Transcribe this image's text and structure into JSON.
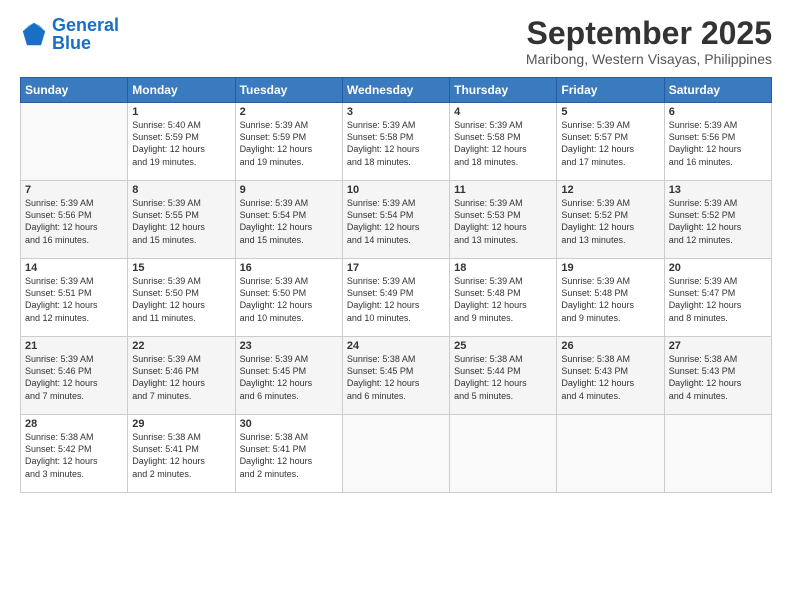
{
  "logo": {
    "line1": "General",
    "line2": "Blue"
  },
  "title": "September 2025",
  "location": "Maribong, Western Visayas, Philippines",
  "days_of_week": [
    "Sunday",
    "Monday",
    "Tuesday",
    "Wednesday",
    "Thursday",
    "Friday",
    "Saturday"
  ],
  "weeks": [
    [
      {
        "day": "",
        "info": ""
      },
      {
        "day": "1",
        "info": "Sunrise: 5:40 AM\nSunset: 5:59 PM\nDaylight: 12 hours\nand 19 minutes."
      },
      {
        "day": "2",
        "info": "Sunrise: 5:39 AM\nSunset: 5:59 PM\nDaylight: 12 hours\nand 19 minutes."
      },
      {
        "day": "3",
        "info": "Sunrise: 5:39 AM\nSunset: 5:58 PM\nDaylight: 12 hours\nand 18 minutes."
      },
      {
        "day": "4",
        "info": "Sunrise: 5:39 AM\nSunset: 5:58 PM\nDaylight: 12 hours\nand 18 minutes."
      },
      {
        "day": "5",
        "info": "Sunrise: 5:39 AM\nSunset: 5:57 PM\nDaylight: 12 hours\nand 17 minutes."
      },
      {
        "day": "6",
        "info": "Sunrise: 5:39 AM\nSunset: 5:56 PM\nDaylight: 12 hours\nand 16 minutes."
      }
    ],
    [
      {
        "day": "7",
        "info": "Sunrise: 5:39 AM\nSunset: 5:56 PM\nDaylight: 12 hours\nand 16 minutes."
      },
      {
        "day": "8",
        "info": "Sunrise: 5:39 AM\nSunset: 5:55 PM\nDaylight: 12 hours\nand 15 minutes."
      },
      {
        "day": "9",
        "info": "Sunrise: 5:39 AM\nSunset: 5:54 PM\nDaylight: 12 hours\nand 15 minutes."
      },
      {
        "day": "10",
        "info": "Sunrise: 5:39 AM\nSunset: 5:54 PM\nDaylight: 12 hours\nand 14 minutes."
      },
      {
        "day": "11",
        "info": "Sunrise: 5:39 AM\nSunset: 5:53 PM\nDaylight: 12 hours\nand 13 minutes."
      },
      {
        "day": "12",
        "info": "Sunrise: 5:39 AM\nSunset: 5:52 PM\nDaylight: 12 hours\nand 13 minutes."
      },
      {
        "day": "13",
        "info": "Sunrise: 5:39 AM\nSunset: 5:52 PM\nDaylight: 12 hours\nand 12 minutes."
      }
    ],
    [
      {
        "day": "14",
        "info": "Sunrise: 5:39 AM\nSunset: 5:51 PM\nDaylight: 12 hours\nand 12 minutes."
      },
      {
        "day": "15",
        "info": "Sunrise: 5:39 AM\nSunset: 5:50 PM\nDaylight: 12 hours\nand 11 minutes."
      },
      {
        "day": "16",
        "info": "Sunrise: 5:39 AM\nSunset: 5:50 PM\nDaylight: 12 hours\nand 10 minutes."
      },
      {
        "day": "17",
        "info": "Sunrise: 5:39 AM\nSunset: 5:49 PM\nDaylight: 12 hours\nand 10 minutes."
      },
      {
        "day": "18",
        "info": "Sunrise: 5:39 AM\nSunset: 5:48 PM\nDaylight: 12 hours\nand 9 minutes."
      },
      {
        "day": "19",
        "info": "Sunrise: 5:39 AM\nSunset: 5:48 PM\nDaylight: 12 hours\nand 9 minutes."
      },
      {
        "day": "20",
        "info": "Sunrise: 5:39 AM\nSunset: 5:47 PM\nDaylight: 12 hours\nand 8 minutes."
      }
    ],
    [
      {
        "day": "21",
        "info": "Sunrise: 5:39 AM\nSunset: 5:46 PM\nDaylight: 12 hours\nand 7 minutes."
      },
      {
        "day": "22",
        "info": "Sunrise: 5:39 AM\nSunset: 5:46 PM\nDaylight: 12 hours\nand 7 minutes."
      },
      {
        "day": "23",
        "info": "Sunrise: 5:39 AM\nSunset: 5:45 PM\nDaylight: 12 hours\nand 6 minutes."
      },
      {
        "day": "24",
        "info": "Sunrise: 5:38 AM\nSunset: 5:45 PM\nDaylight: 12 hours\nand 6 minutes."
      },
      {
        "day": "25",
        "info": "Sunrise: 5:38 AM\nSunset: 5:44 PM\nDaylight: 12 hours\nand 5 minutes."
      },
      {
        "day": "26",
        "info": "Sunrise: 5:38 AM\nSunset: 5:43 PM\nDaylight: 12 hours\nand 4 minutes."
      },
      {
        "day": "27",
        "info": "Sunrise: 5:38 AM\nSunset: 5:43 PM\nDaylight: 12 hours\nand 4 minutes."
      }
    ],
    [
      {
        "day": "28",
        "info": "Sunrise: 5:38 AM\nSunset: 5:42 PM\nDaylight: 12 hours\nand 3 minutes."
      },
      {
        "day": "29",
        "info": "Sunrise: 5:38 AM\nSunset: 5:41 PM\nDaylight: 12 hours\nand 2 minutes."
      },
      {
        "day": "30",
        "info": "Sunrise: 5:38 AM\nSunset: 5:41 PM\nDaylight: 12 hours\nand 2 minutes."
      },
      {
        "day": "",
        "info": ""
      },
      {
        "day": "",
        "info": ""
      },
      {
        "day": "",
        "info": ""
      },
      {
        "day": "",
        "info": ""
      }
    ]
  ]
}
